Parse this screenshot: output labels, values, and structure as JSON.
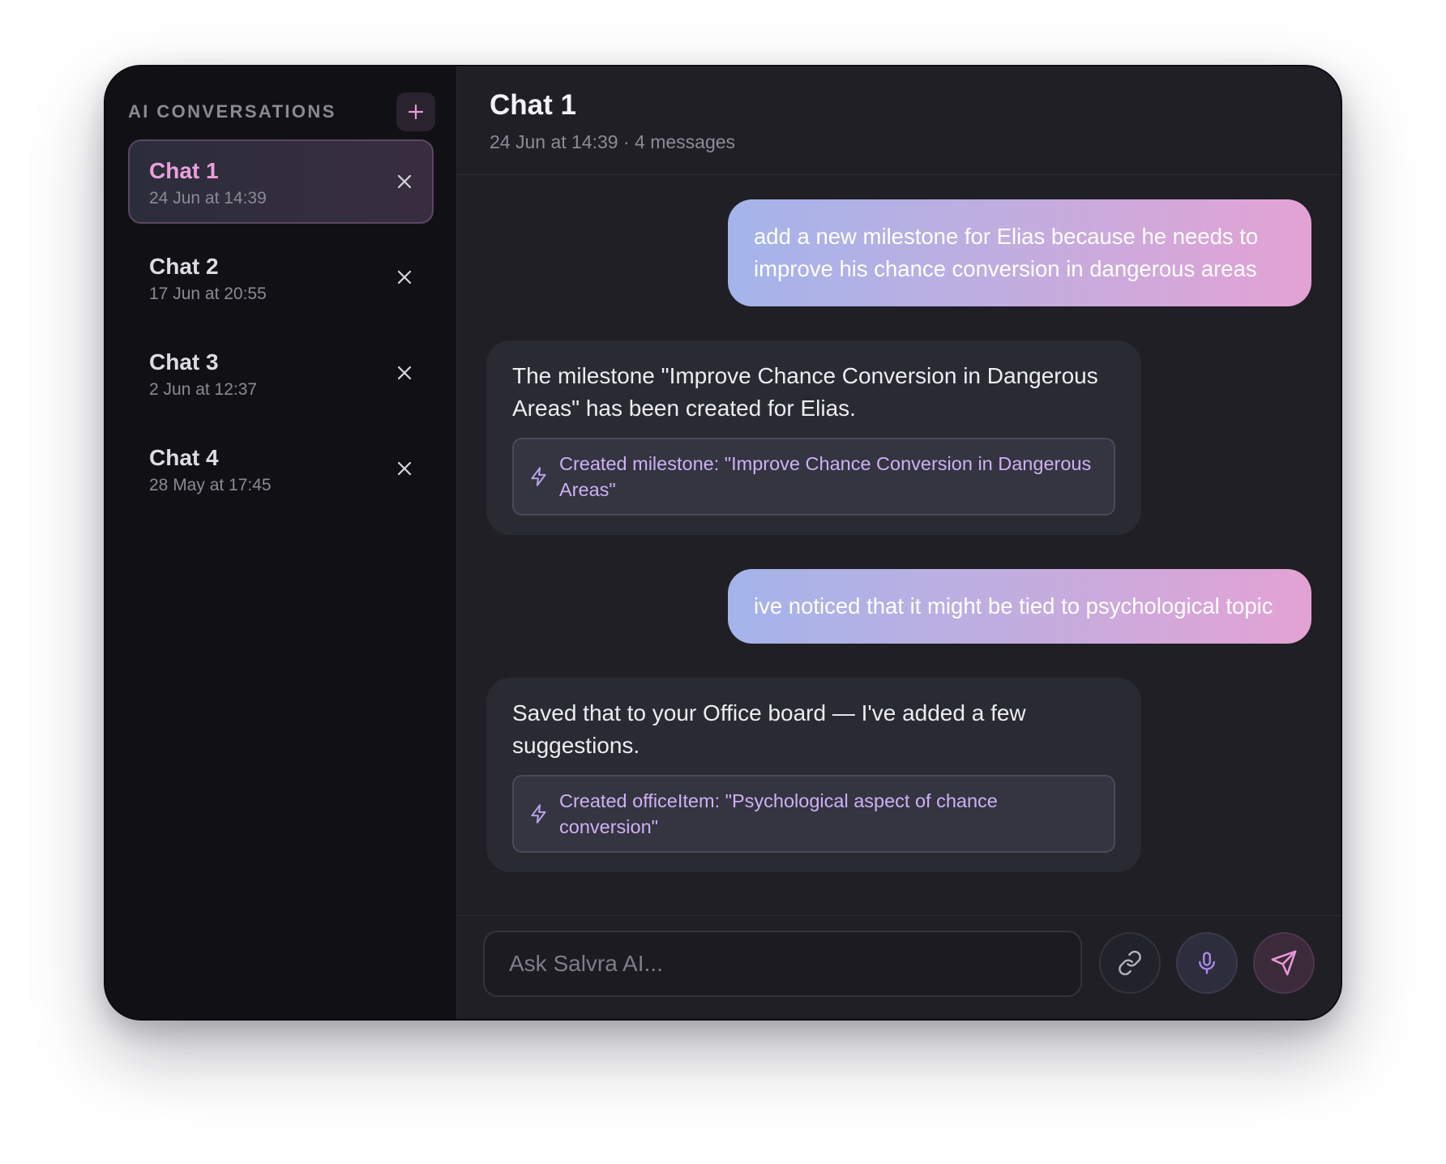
{
  "sidebar": {
    "title": "AI CONVERSATIONS",
    "new_chat_icon": "plus-icon",
    "chats": [
      {
        "name": "Chat 1",
        "date": "24 Jun at 14:39",
        "active": true
      },
      {
        "name": "Chat 2",
        "date": "17 Jun at 20:55",
        "active": false
      },
      {
        "name": "Chat 3",
        "date": "2 Jun at 12:37",
        "active": false
      },
      {
        "name": "Chat 4",
        "date": "28 May at 17:45",
        "active": false
      }
    ]
  },
  "header": {
    "title": "Chat 1",
    "meta": "24 Jun at 14:39 · 4 messages"
  },
  "messages": [
    {
      "role": "user",
      "text": "add a new milestone for Elias because he needs to improve his chance conversion in dangerous areas"
    },
    {
      "role": "assistant",
      "text": "The milestone \"Improve Chance Conversion in Dangerous Areas\" has been created for Elias.",
      "action": "Created milestone: \"Improve Chance Conversion in Dangerous Areas\""
    },
    {
      "role": "user",
      "text": "ive noticed that it might be tied to psychological topic"
    },
    {
      "role": "assistant",
      "text": "Saved that to your Office board — I've added a few suggestions.",
      "action": "Created officeItem: \"Psychological aspect of chance conversion\""
    }
  ],
  "composer": {
    "placeholder": "Ask Salvra AI...",
    "value": ""
  },
  "colors": {
    "accent_pink": "#eaa0dc",
    "accent_purple": "#a98be8",
    "user_gradient_start": "#a4b4ea",
    "user_gradient_end": "#e4a2d4"
  }
}
